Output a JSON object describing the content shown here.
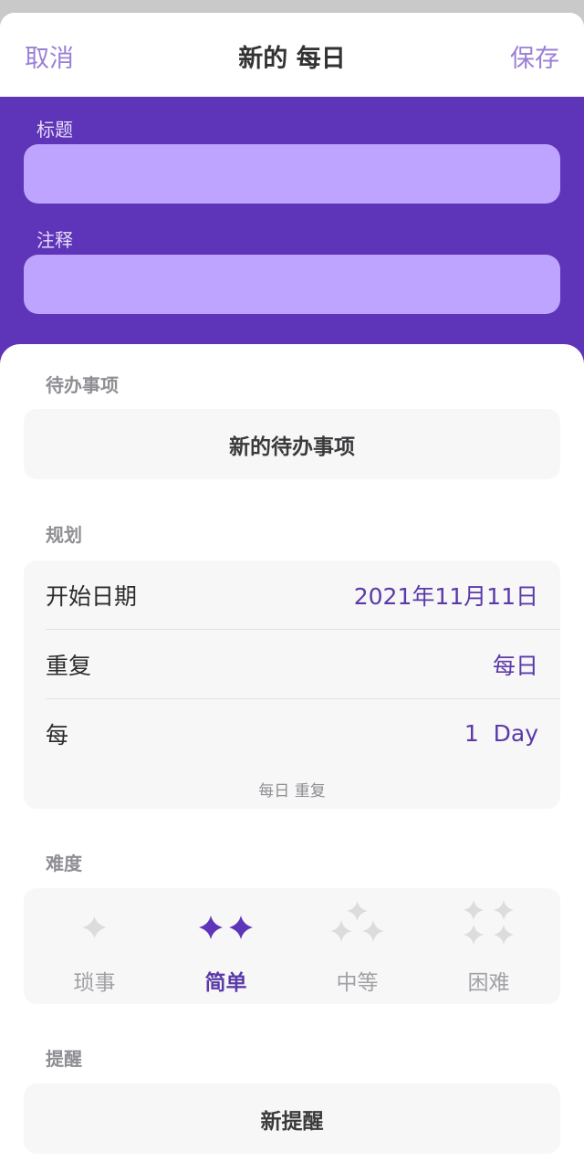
{
  "nav": {
    "cancel_label": "取消",
    "title": "新的 每日",
    "save_label": "保存"
  },
  "form": {
    "title_label": "标题",
    "title_value": "",
    "notes_label": "注释",
    "notes_value": ""
  },
  "checklist": {
    "section_label": "待办事项",
    "new_item_label": "新的待办事项"
  },
  "schedule": {
    "section_label": "规划",
    "rows": [
      {
        "label": "开始日期",
        "value": "2021年11月11日"
      },
      {
        "label": "重复",
        "value": "每日"
      },
      {
        "label": "每",
        "value": "1  Day"
      }
    ],
    "summary": "每日 重复"
  },
  "difficulty": {
    "section_label": "难度",
    "options": [
      {
        "label": "琐事",
        "selected": false,
        "icon": "sparkle-1-icon"
      },
      {
        "label": "简单",
        "selected": true,
        "icon": "sparkle-2-icon"
      },
      {
        "label": "中等",
        "selected": false,
        "icon": "sparkle-3-icon"
      },
      {
        "label": "困难",
        "selected": false,
        "icon": "sparkle-4-icon"
      }
    ]
  },
  "reminders": {
    "section_label": "提醒",
    "new_reminder_label": "新提醒"
  },
  "colors": {
    "accent": "#5e34b8",
    "input_fill": "#bea4fe",
    "selected_text": "#5b3aa8",
    "unselected_sparkle": "#dcdcdc"
  }
}
